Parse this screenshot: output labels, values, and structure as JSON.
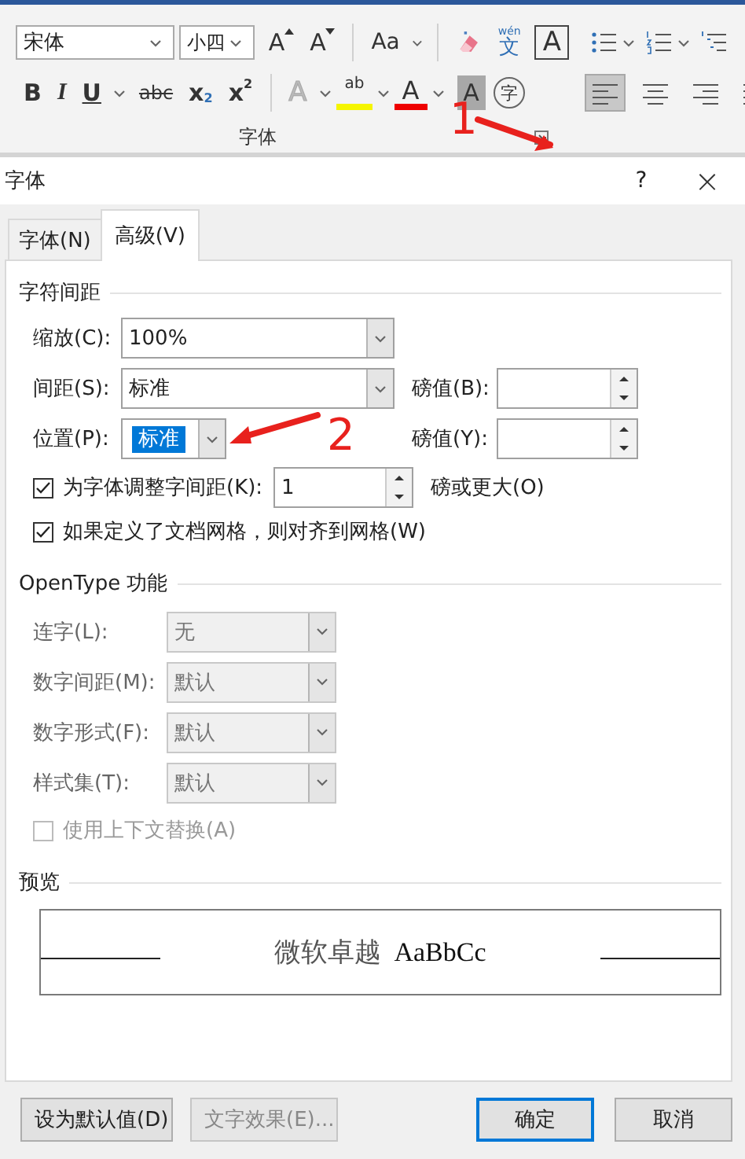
{
  "ribbon": {
    "font_name": "宋体",
    "font_size": "小四",
    "row1": [
      {
        "kind": "grow",
        "label": "A"
      },
      {
        "kind": "shrink",
        "label": "A"
      },
      {
        "kind": "sep"
      },
      {
        "kind": "case",
        "label": "Aa",
        "caret": true
      },
      {
        "kind": "sep"
      },
      {
        "kind": "eraser"
      },
      {
        "kind": "phonetic",
        "label": "文",
        "ruby": "wén"
      },
      {
        "kind": "boxed",
        "label": "A"
      }
    ],
    "row2": [
      {
        "kind": "bold",
        "label": "B"
      },
      {
        "kind": "italic",
        "label": "I"
      },
      {
        "kind": "underline",
        "label": "U",
        "caret": true
      },
      {
        "kind": "strike",
        "label": "abc"
      },
      {
        "kind": "sub",
        "label": "x",
        "script": "2"
      },
      {
        "kind": "sup",
        "label": "x",
        "script": "2"
      },
      {
        "kind": "sep"
      },
      {
        "kind": "effect",
        "label": "A",
        "caret": true
      },
      {
        "kind": "highlight",
        "label": "ab",
        "caret": true
      },
      {
        "kind": "color",
        "label": "A",
        "caret": true
      },
      {
        "kind": "shading",
        "label": "A"
      },
      {
        "kind": "enclose",
        "label": "字"
      }
    ],
    "group_label": "字体",
    "list_buttons": [
      {
        "kind": "bullets",
        "caret": true
      },
      {
        "kind": "numbering",
        "caret": true
      },
      {
        "kind": "multilevel",
        "caret": false
      }
    ],
    "align_buttons": [
      {
        "kind": "left",
        "selected": true
      },
      {
        "kind": "center",
        "selected": false
      },
      {
        "kind": "right",
        "selected": false
      },
      {
        "kind": "justify",
        "selected": false
      }
    ]
  },
  "dialog": {
    "title": "字体",
    "help": "?",
    "close": "×",
    "tabs": [
      {
        "label": "字体(N)",
        "selected": false
      },
      {
        "label": "高级(V)",
        "selected": true
      }
    ],
    "spacing": {
      "title": "字符间距",
      "rows": [
        {
          "kind": "combo",
          "label": "缩放(C):",
          "value": "100%",
          "highlighted": false,
          "disabled": false
        },
        {
          "kind": "combo",
          "label": "间距(S):",
          "value": "标准",
          "highlighted": false,
          "disabled": false,
          "spin": {
            "label": "磅值(B):"
          }
        },
        {
          "kind": "combo",
          "label": "位置(P):",
          "value": "标准",
          "highlighted": true,
          "disabled": false,
          "spin": {
            "label": "磅值(Y):"
          }
        },
        {
          "kind": "checkbox",
          "label": "为字体调整字间距(K):",
          "checked": true,
          "disabled": false,
          "spin": {
            "value": "1"
          },
          "suffix": "磅或更大(O)"
        },
        {
          "kind": "checkbox",
          "label": "如果定义了文档网格，则对齐到网格(W)",
          "checked": true,
          "disabled": false
        }
      ]
    },
    "opentype": {
      "title": "OpenType 功能",
      "rows": [
        {
          "kind": "combo",
          "label": "连字(L):",
          "value": "无",
          "highlighted": false,
          "disabled": true
        },
        {
          "kind": "combo",
          "label": "数字间距(M):",
          "value": "默认",
          "highlighted": false,
          "disabled": true
        },
        {
          "kind": "combo",
          "label": "数字形式(F):",
          "value": "默认",
          "highlighted": false,
          "disabled": true
        },
        {
          "kind": "combo",
          "label": "样式集(T):",
          "value": "默认",
          "highlighted": false,
          "disabled": true
        },
        {
          "kind": "checkbox",
          "label": "使用上下文替换(A)",
          "checked": false,
          "disabled": true
        }
      ]
    },
    "preview": {
      "title": "预览",
      "sample_cjk": "微软卓越",
      "sample_latin": "AaBbCc"
    },
    "buttons": [
      {
        "label": "设为默认值(D)",
        "disabled": false,
        "default": false
      },
      {
        "label": "文字效果(E)...",
        "disabled": true,
        "default": false
      },
      {
        "label": "确定",
        "disabled": false,
        "default": true
      },
      {
        "label": "取消",
        "disabled": false,
        "default": false
      }
    ]
  },
  "annotations": [
    {
      "label": "1"
    },
    {
      "label": "2"
    }
  ]
}
